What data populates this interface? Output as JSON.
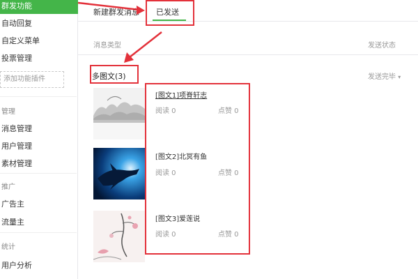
{
  "sidebar": {
    "active_label": "群发功能",
    "items": [
      {
        "label": "自动回复"
      },
      {
        "label": "自定义菜单"
      },
      {
        "label": "投票管理"
      }
    ],
    "add_plugin_label": "添加功能插件",
    "groups": [
      {
        "label": "管理",
        "items": [
          "消息管理",
          "用户管理",
          "素材管理"
        ]
      },
      {
        "label": "推广",
        "items": [
          "广告主",
          "流量主"
        ]
      },
      {
        "label": "统计",
        "items": [
          "用户分析"
        ]
      }
    ]
  },
  "tabs": {
    "new_label": "新建群发消息",
    "sent_label": "已发送"
  },
  "table": {
    "col_type": "消息类型",
    "col_status": "发送状态"
  },
  "group": {
    "title": "多图文(3)",
    "status": "发送完毕"
  },
  "articles": [
    {
      "title": "[图文1]项脊轩志",
      "reads_label": "阅读 0",
      "likes_label": "点赞 0"
    },
    {
      "title": "[图文2]北冥有鱼",
      "reads_label": "阅读 0",
      "likes_label": "点赞 0"
    },
    {
      "title": "[图文3]爱莲说",
      "reads_label": "阅读 0",
      "likes_label": "点赞 0"
    }
  ],
  "colors": {
    "accent": "#44b549",
    "annotation": "#e3313a"
  }
}
